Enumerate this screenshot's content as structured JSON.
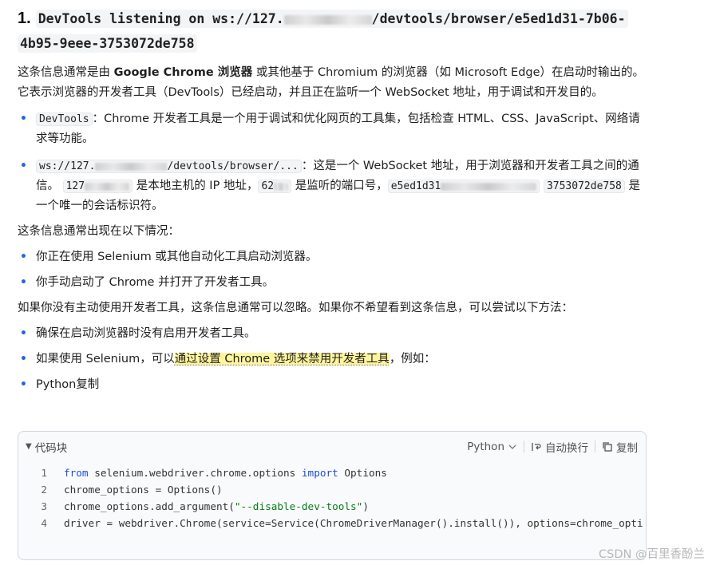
{
  "heading": {
    "number": "1.",
    "code_part1": "DevTools listening on ws://127.",
    "code_part2": "/devtools/browser/e5ed1d31-7b06-",
    "code_part3": "4b95-9eee-3753072de758"
  },
  "intro": {
    "p1": "这条信息通常是由 ",
    "bold": "Google Chrome 浏览器",
    "p2": " 或其他基于 Chromium 的浏览器（如 Microsoft Edge）在启动时输出的。它表示浏览器的开发者工具（DevTools）已经启动，并且正在监听一个 WebSocket 地址，用于调试和开发目的。"
  },
  "bullets1": [
    {
      "code": "DevTools",
      "text": "：Chrome 开发者工具是一个用于调试和优化网页的工具集，包括检查 HTML、CSS、JavaScript、网络请求等功能。"
    },
    {
      "code_a": "ws://127.",
      "code_b": "/devtools/browser/...",
      "text_a": "：这是一个 WebSocket 地址，用于浏览器和开发者工具之间的通信。",
      "code_ip": "127",
      "text_b": " 是本地主机的 IP 地址，",
      "code_port": "62",
      "text_c": " 是监听的端口号，",
      "code_id_a": "e5ed1d31",
      "code_id_b": "3753072de758",
      "text_d": " 是一个唯一的会话标识符。"
    }
  ],
  "situations_intro": "这条信息通常出现在以下情况：",
  "bullets2": [
    "你正在使用 Selenium 或其他自动化工具启动浏览器。",
    "你手动启动了 Chrome 并打开了开发者工具。"
  ],
  "ignore_text": "如果你没有主动使用开发者工具，这条信息通常可以忽略。如果你不希望看到这条信息，可以尝试以下方法：",
  "bullets3": {
    "item1": "确保在启动浏览器时没有启用开发者工具。",
    "item2_pre": "如果使用 Selenium，可以",
    "item2_hl": "通过设置 Chrome 选项来禁用开发者工具",
    "item2_post": "，例如：",
    "item3": "Python复制"
  },
  "codeblock": {
    "title": "代码块",
    "language": "Python",
    "wrap_label": "自动换行",
    "copy_label": "复制",
    "lines": [
      {
        "num": "1",
        "t1": "from",
        "t2": " selenium.webdriver.chrome.options ",
        "t3": "import",
        "t4": " Options"
      },
      {
        "num": "2",
        "text": "chrome_options = Options()"
      },
      {
        "num": "3",
        "pre": "chrome_options.add_argument(",
        "str": "\"--disable-dev-tools\"",
        "post": ")"
      },
      {
        "num": "4",
        "text": "driver = webdriver.Chrome(service=Service(ChromeDriverManager().install()), options=chrome_opti"
      }
    ]
  },
  "watermark": "CSDN @百里香酚兰",
  "colors": {
    "bullet": "#2563eb",
    "highlight": "#fff59d",
    "keyword": "#1d4ed8",
    "string": "#067d17"
  },
  "icons": {
    "collapse": "triangle-down-icon",
    "dropdown": "chevron-down-icon",
    "wrap": "wrap-icon",
    "copy": "copy-icon"
  }
}
